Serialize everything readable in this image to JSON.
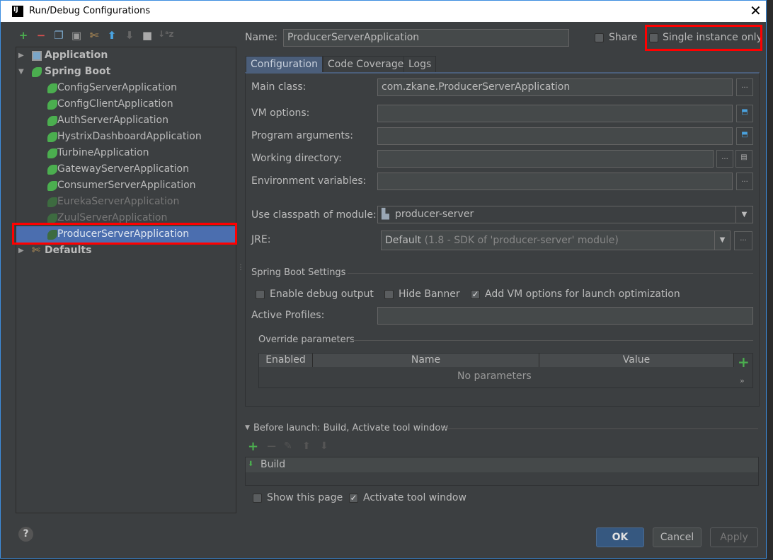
{
  "window": {
    "title": "Run/Debug Configurations",
    "logo": "IJ",
    "close": "✕"
  },
  "toolbar": {
    "icons": [
      "add-icon",
      "remove-icon",
      "copy-icon",
      "save-icon",
      "edit-defaults-icon",
      "move-up-icon",
      "move-down-icon",
      "folder-icon",
      "sort-icon"
    ]
  },
  "tree": {
    "groups": [
      {
        "label": "Application",
        "expanded": false
      },
      {
        "label": "Spring Boot",
        "expanded": true
      },
      {
        "label": "Defaults",
        "expanded": false
      }
    ],
    "items": [
      {
        "label": "ConfigServerApplication",
        "disabled": false
      },
      {
        "label": "ConfigClientApplication",
        "disabled": false
      },
      {
        "label": "AuthServerApplication",
        "disabled": false
      },
      {
        "label": "HystrixDashboardApplication",
        "disabled": false
      },
      {
        "label": "TurbineApplication",
        "disabled": false
      },
      {
        "label": "GatewayServerApplication",
        "disabled": false
      },
      {
        "label": "ConsumerServerApplication",
        "disabled": false
      },
      {
        "label": "EurekaServerApplication",
        "disabled": true
      },
      {
        "label": "ZuulServerApplication",
        "disabled": true
      },
      {
        "label": "ProducerServerApplication",
        "disabled": true,
        "selected": true
      }
    ]
  },
  "name": {
    "label": "Name:",
    "value": "ProducerServerApplication"
  },
  "share": {
    "label": "Share",
    "checked": false
  },
  "single_instance": {
    "label": "Single instance only",
    "checked": false
  },
  "tabs": [
    {
      "label": "Configuration",
      "active": true
    },
    {
      "label": "Code Coverage"
    },
    {
      "label": "Logs"
    }
  ],
  "config": {
    "main_class": {
      "label": "Main class:",
      "value": "com.zkane.ProducerServerApplication"
    },
    "vm_options": {
      "label": "VM options:",
      "value": ""
    },
    "program_arguments": {
      "label": "Program arguments:",
      "value": ""
    },
    "working_directory": {
      "label": "Working directory:",
      "value": ""
    },
    "env_vars": {
      "label": "Environment variables:",
      "value": ""
    },
    "classpath": {
      "label": "Use classpath of module:",
      "value": "producer-server"
    },
    "jre": {
      "label": "JRE:",
      "value": "Default",
      "hint": "(1.8 - SDK of 'producer-server' module)"
    },
    "ellipsis": "...",
    "spring_boot_settings": "Spring Boot Settings",
    "enable_debug": {
      "label": "Enable debug output",
      "checked": false
    },
    "hide_banner": {
      "label": "Hide Banner",
      "checked": false
    },
    "add_vm": {
      "label": "Add VM options for launch optimization",
      "checked": true
    },
    "active_profiles": {
      "label": "Active Profiles:",
      "value": ""
    },
    "override": {
      "label": "Override parameters",
      "columns": [
        "Enabled",
        "Name",
        "Value"
      ],
      "empty": "No parameters",
      "add": "+",
      "more": "»"
    }
  },
  "before_launch": {
    "label": "Before launch: Build, Activate tool window",
    "items": [
      "Build"
    ],
    "icons": [
      "add-icon",
      "remove-icon",
      "edit-icon",
      "move-up-icon",
      "move-down-icon"
    ]
  },
  "show_page": {
    "label": "Show this page",
    "checked": false
  },
  "activate_tool": {
    "label": "Activate tool window",
    "checked": true
  },
  "buttons": {
    "ok": "OK",
    "cancel": "Cancel",
    "apply": "Apply"
  },
  "help": "?",
  "colors": {
    "accent": "#4b6eaf",
    "highlight": "#ff0000",
    "add": "#4bae4f",
    "background": "#3c3f41"
  }
}
